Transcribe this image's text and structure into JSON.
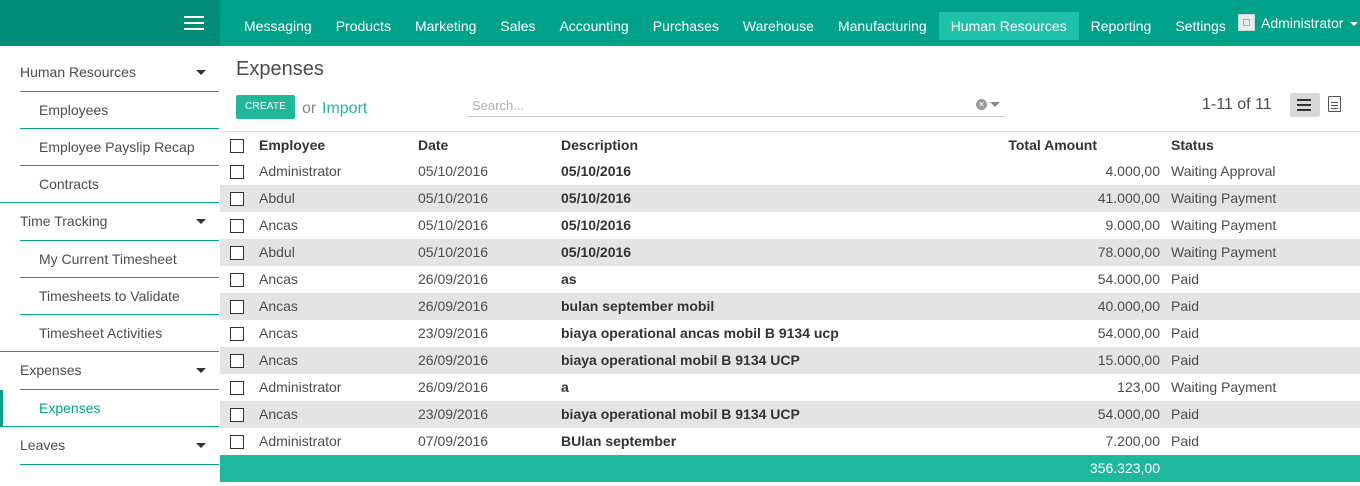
{
  "topbar": {
    "menu_items": [
      "Messaging",
      "Products",
      "Marketing",
      "Sales",
      "Accounting",
      "Purchases",
      "Warehouse",
      "Manufacturing",
      "Human Resources",
      "Reporting",
      "Settings"
    ],
    "active_item": "Human Resources",
    "user_name": "Administrator",
    "accent_color": "#00a38a"
  },
  "sidebar": {
    "sections": [
      {
        "label": "Human Resources",
        "items": [
          "Employees",
          "Employee Payslip Recap",
          "Contracts"
        ]
      },
      {
        "label": "Time Tracking",
        "items": [
          "My Current Timesheet",
          "Timesheets to Validate",
          "Timesheet Activities"
        ]
      },
      {
        "label": "Expenses",
        "items": [
          "Expenses"
        ]
      },
      {
        "label": "Leaves",
        "items": []
      }
    ],
    "active_item": "Expenses"
  },
  "control_panel": {
    "title": "Expenses",
    "create_label": "CREATE",
    "or_label": "or",
    "import_label": "Import",
    "search_placeholder": "Search...",
    "pager": "1-11 of 11"
  },
  "table": {
    "columns": [
      "Employee",
      "Date",
      "Description",
      "Total Amount",
      "Status"
    ],
    "rows": [
      {
        "employee": "Administrator",
        "date": "05/10/2016",
        "description": "05/10/2016",
        "amount": "4.000,00",
        "status": "Waiting Approval"
      },
      {
        "employee": "Abdul",
        "date": "05/10/2016",
        "description": "05/10/2016",
        "amount": "41.000,00",
        "status": "Waiting Payment"
      },
      {
        "employee": "Ancas",
        "date": "05/10/2016",
        "description": "05/10/2016",
        "amount": "9.000,00",
        "status": "Waiting Payment"
      },
      {
        "employee": "Abdul",
        "date": "05/10/2016",
        "description": "05/10/2016",
        "amount": "78.000,00",
        "status": "Waiting Payment"
      },
      {
        "employee": "Ancas",
        "date": "26/09/2016",
        "description": "as",
        "amount": "54.000,00",
        "status": "Paid"
      },
      {
        "employee": "Ancas",
        "date": "26/09/2016",
        "description": "bulan september mobil",
        "amount": "40.000,00",
        "status": "Paid"
      },
      {
        "employee": "Ancas",
        "date": "23/09/2016",
        "description": "biaya operational ancas mobil B 9134 ucp",
        "amount": "54.000,00",
        "status": "Paid"
      },
      {
        "employee": "Ancas",
        "date": "26/09/2016",
        "description": "biaya operational mobil B 9134 UCP",
        "amount": "15.000,00",
        "status": "Paid"
      },
      {
        "employee": "Administrator",
        "date": "26/09/2016",
        "description": "a",
        "amount": "123,00",
        "status": "Waiting Payment"
      },
      {
        "employee": "Ancas",
        "date": "23/09/2016",
        "description": "biaya operational mobil B 9134 UCP",
        "amount": "54.000,00",
        "status": "Paid"
      },
      {
        "employee": "Administrator",
        "date": "07/09/2016",
        "description": "BUlan september",
        "amount": "7.200,00",
        "status": "Paid"
      }
    ],
    "total": "356.323,00"
  }
}
